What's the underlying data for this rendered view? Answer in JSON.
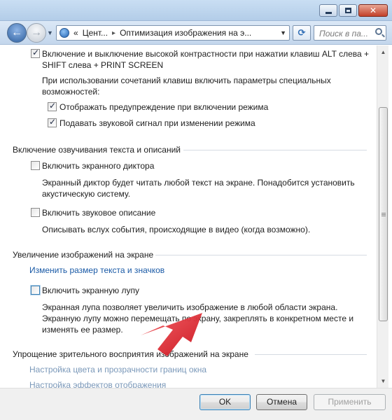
{
  "address_bar": {
    "back_glyph": "«",
    "segment_1": "Цент...",
    "separator": "▸",
    "segment_2": "Оптимизация изображения на э...",
    "dropdown_icon": "chevron-down-icon"
  },
  "search": {
    "placeholder": "Поиск в па..."
  },
  "settings": {
    "high_contrast": {
      "checkbox_label": "Включение и выключение высокой контрастности при нажатии клавиш ALT слева + SHIFT слева + PRINT SCREEN",
      "checked": true,
      "note": "При использовании сочетаний клавиш включить параметры специальных возможностей:",
      "warning_label": "Отображать предупреждение при включении режима",
      "warning_checked": true,
      "sound_label": "Подавать звуковой сигнал при изменении режима",
      "sound_checked": true
    },
    "narration": {
      "heading": "Включение озвучивания текста и описаний",
      "narrator_label": "Включить экранного диктора",
      "narrator_checked": false,
      "narrator_desc": "Экранный диктор будет читать любой текст на экране. Понадобится установить акустическую систему.",
      "audio_desc_label": "Включить звуковое описание",
      "audio_desc_checked": false,
      "audio_desc_desc": "Описывать вслух события, происходящие в видео (когда возможно)."
    },
    "magnify": {
      "heading": "Увеличение изображений на экране",
      "resize_link": "Изменить размер текста и значков",
      "magnifier_label": "Включить экранную лупу",
      "magnifier_checked": false,
      "magnifier_desc": "Экранная лупа позволяет увеличить изображение в любой области экрана. Экранную лупу можно перемещать по экрану, закреплять в конкретном месте и изменять ее размер."
    },
    "simplify": {
      "heading": "Упрощение зрительного восприятия изображений на экране",
      "color_link": "Настройка цвета и прозрачности границ окна",
      "effects_link": "Настройка эффектов отображения"
    }
  },
  "buttons": {
    "ok": "OK",
    "cancel": "Отмена",
    "apply": "Применить"
  },
  "colors": {
    "link": "#1a5aa6",
    "annotation_arrow": "#e8202a"
  }
}
